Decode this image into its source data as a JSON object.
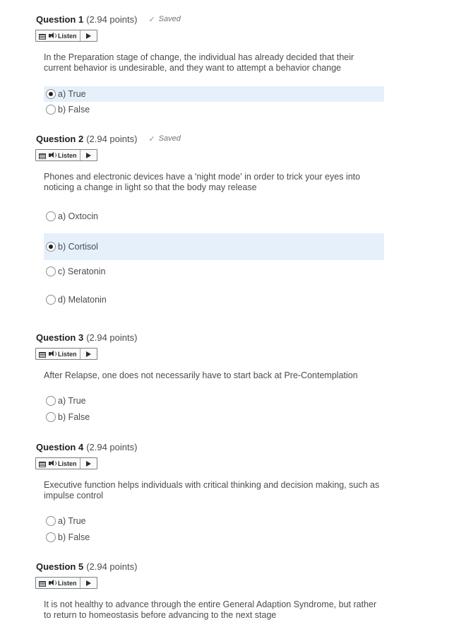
{
  "questions": [
    {
      "title": "Question 1",
      "points": "(2.94 points)",
      "saved": "Saved",
      "listen_label": "Listen",
      "text": "In the Preparation stage of change, the individual has already decided that their current behavior is undesirable, and they want to attempt a behavior change",
      "choices": [
        {
          "label": "a) True",
          "selected": true
        },
        {
          "label": "b) False",
          "selected": false
        }
      ]
    },
    {
      "title": "Question 2",
      "points": "(2.94 points)",
      "saved": "Saved",
      "listen_label": "Listen",
      "text": "Phones and electronic devices have a 'night mode' in order to trick your eyes into noticing a change in light so that the body may release",
      "choices": [
        {
          "label": "a) Oxtocin",
          "selected": false
        },
        {
          "label": "b) Cortisol",
          "selected": true
        },
        {
          "label": "c) Seratonin",
          "selected": false
        },
        {
          "label": "d) Melatonin",
          "selected": false
        }
      ]
    },
    {
      "title": "Question 3",
      "points": "(2.94 points)",
      "listen_label": "Listen",
      "text": "After Relapse, one does not necessarily have to start back at Pre-Contemplation",
      "choices": [
        {
          "label": "a) True",
          "selected": false
        },
        {
          "label": "b) False",
          "selected": false
        }
      ]
    },
    {
      "title": "Question 4",
      "points": "(2.94 points)",
      "listen_label": "Listen",
      "text": "Executive function helps individuals with critical thinking and decision making, such as impulse control",
      "choices": [
        {
          "label": "a) True",
          "selected": false
        },
        {
          "label": "b) False",
          "selected": false
        }
      ]
    },
    {
      "title": "Question 5",
      "points": "(2.94 points)",
      "listen_label": "Listen",
      "text": "It is not healthy to advance through the entire General Adaption Syndrome, but rather to return to homeostasis before advancing to the next stage"
    }
  ]
}
